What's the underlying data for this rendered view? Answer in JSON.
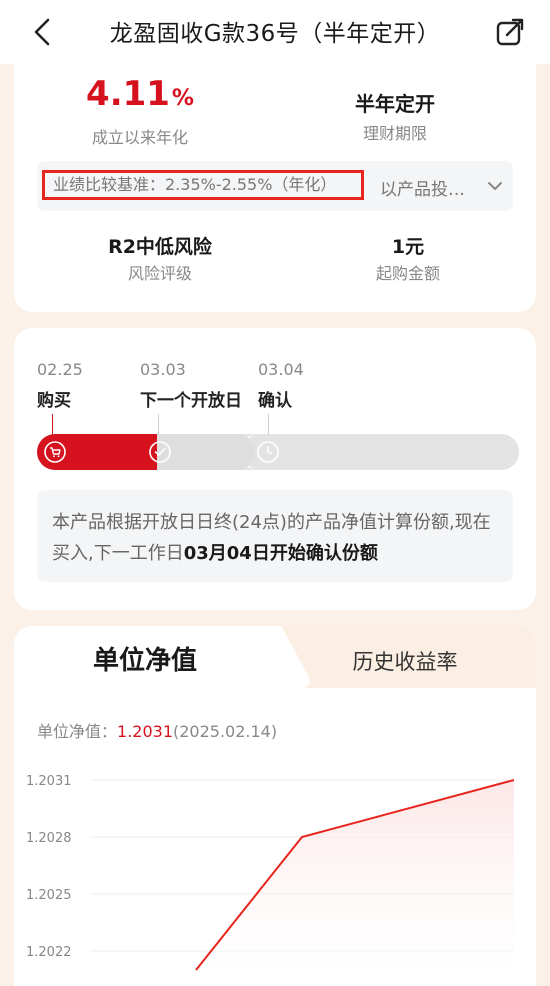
{
  "header": {
    "title": "龙盈固收G款36号（半年定开）"
  },
  "summary": {
    "rate_value": "4.11",
    "rate_unit": "%",
    "rate_label": "成立以来年化",
    "term_value": "半年定开",
    "term_label": "理财期限",
    "benchmark_text": "业绩比较基准：2.35%-2.55%（年化）",
    "benchmark_more": "以产品投…",
    "risk_value": "R2中低风险",
    "risk_label": "风险评级",
    "min_amount_value": "1元",
    "min_amount_label": "起购金额"
  },
  "timeline": {
    "steps": [
      {
        "date": "02.25",
        "name": "购买"
      },
      {
        "date": "03.03",
        "name": "下一个开放日"
      },
      {
        "date": "03.04",
        "name": "确认"
      }
    ],
    "note_prefix": "本产品根据开放日日终(24点)的产品净值计算份额,现在买入,下一工作日",
    "note_bold": "03月04日开始确认份额"
  },
  "nav_section": {
    "tabs": [
      "单位净值",
      "历史收益率"
    ],
    "nav_label": "单位净值：",
    "nav_value": "1.2031",
    "nav_date": "(2025.02.14)"
  },
  "chart_data": {
    "type": "area",
    "y_ticks": [
      "1.2031",
      "1.2028",
      "1.2025",
      "1.2022"
    ],
    "ylim": [
      1.2022,
      1.2031
    ],
    "grid": true,
    "series": [
      {
        "values": [
          1.2021,
          1.2028,
          1.2031
        ]
      }
    ],
    "x_fraction": [
      0.25,
      0.5,
      1.0
    ],
    "colors": {
      "line": "#e8251c",
      "fill": "#fce4e4"
    }
  },
  "colors": {
    "accent": "#d6121f",
    "highlight_box": "#e8251c"
  }
}
